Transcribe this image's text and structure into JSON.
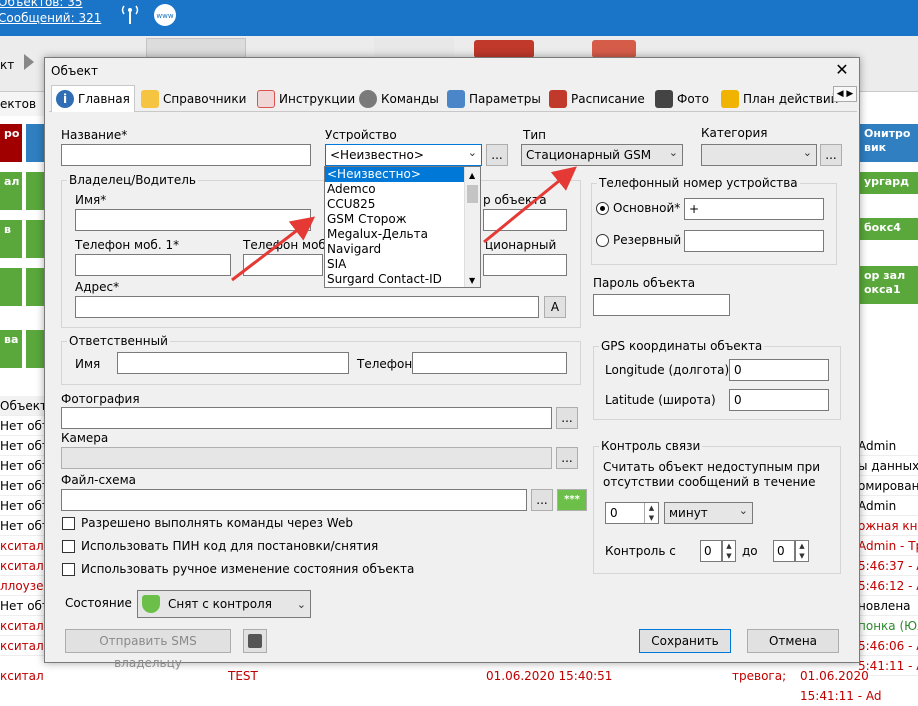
{
  "background": {
    "top_line1": "Объектов: 35",
    "top_line2": "Сообщений: 321",
    "toolbar_left_label": "кт",
    "left_col_header": "ектов",
    "left_tiles": [
      "ро",
      "ал",
      "в",
      "",
      "ва"
    ],
    "right_tiles": [
      "Онитро\nвик",
      "ургард",
      "бокс4",
      "ор зал\nокса1"
    ],
    "list_header_left": "Объект",
    "list_rows_left": [
      "Нет объе",
      "Нет объе",
      "Нет объе",
      "Нет объе",
      "Нет объе",
      "Нет объе",
      "кситал",
      "кситал",
      "ллоузел",
      "Нет объе",
      "кситал",
      "кситал"
    ],
    "list_rows_right": [
      "Admin",
      "ы данных у",
      "омирования",
      "Admin",
      "ожная кноп",
      "Admin - Тр",
      "5:46:37 - Ad",
      "5:46:12 - Ad",
      "новлена",
      "понка (Юля",
      "5:46:06 - Ad",
      "5:41:11 - Ad"
    ],
    "bottom_row": {
      "c1": "кситал",
      "c2": "TEST",
      "c3": "01.06.2020 15:40:51",
      "c4": "тревога;",
      "c5": "01.06.2020 15:41:11 - Ad"
    }
  },
  "dialog": {
    "title": "Объект",
    "tabs": [
      {
        "label": "Главная",
        "icon": "info-icon",
        "color": "#2f6db5"
      },
      {
        "label": "Справочники",
        "icon": "envelope-icon",
        "color": "#e8a91c"
      },
      {
        "label": "Инструкции",
        "icon": "notebook-icon",
        "color": "#d9534f"
      },
      {
        "label": "Команды",
        "icon": "gear-icon",
        "color": "#7a7a7a"
      },
      {
        "label": "Параметры",
        "icon": "parameters-icon",
        "color": "#4a86c8"
      },
      {
        "label": "Расписание",
        "icon": "calendar-icon",
        "color": "#c0392b"
      },
      {
        "label": "Фото",
        "icon": "camera-icon",
        "color": "#444444"
      },
      {
        "label": "План действий",
        "icon": "plan-icon",
        "color": "#f0b400"
      }
    ],
    "name_label": "Название*",
    "name_value": "",
    "device_label": "Устройство",
    "device_value": "<Неизвестно>",
    "device_options": [
      "<Неизвестно>",
      "Ademco",
      "CCU825",
      "GSM Сторож",
      "Megalux-Дельта",
      "Navigard",
      "SIA",
      "Surgard Contact-ID"
    ],
    "type_label": "Тип",
    "type_value": "Стационарный GSM",
    "category_label": "Категория",
    "category_value": "",
    "owner_group": "Владелец/Водитель",
    "owner_name_label": "Имя*",
    "phone_mob1_label": "Телефон моб. 1*",
    "phone_mob2_label": "Телефон моб.",
    "object_num_label": "р объекта",
    "stationary_label": "ционарный",
    "address_label": "Адрес*",
    "address_btn": "A",
    "responsible_group": "Ответственный",
    "resp_name_label": "Имя",
    "resp_phone_label": "Телефон",
    "photo_label": "Фотография",
    "camera_label": "Камера",
    "file_label": "Файл-схема",
    "file_btn2": "***",
    "browse": "...",
    "chk_web": "Разрешено выполнять команды через Web",
    "chk_pin": "Использовать ПИН код для постановки/снятия",
    "chk_manual": "Использовать ручное изменение состояния объекта",
    "state_label": "Состояние",
    "state_value": "Снят с контроля",
    "send_sms": "Отправить SMS владельцу",
    "save": "Сохранить",
    "cancel": "Отмена",
    "device_phone_group": "Телефонный номер устройства",
    "primary_label": "Основной*",
    "primary_value": "+",
    "backup_label": "Резервный",
    "backup_value": "",
    "password_label": "Пароль объекта",
    "password_value": "",
    "gps_group": "GPS координаты объекта",
    "lon_label": "Longitude (долгота)",
    "lon_value": "0",
    "lat_label": "Latitude (широта)",
    "lat_value": "0",
    "conn_group": "Контроль связи",
    "conn_text1": "Считать объект недоступным при",
    "conn_text2": "отсутствии сообщений в течение",
    "conn_num": "0",
    "conn_unit": "минут",
    "ctrl_label": "Контроль с",
    "ctrl_from": "0",
    "ctrl_to_label": "до",
    "ctrl_to": "0"
  }
}
